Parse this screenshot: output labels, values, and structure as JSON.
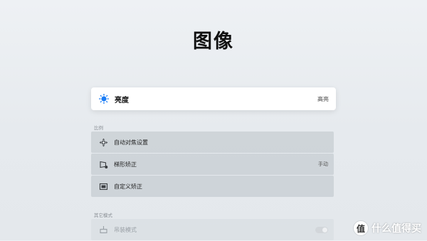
{
  "title": "图像",
  "brightness": {
    "label": "亮度",
    "value": "高亮",
    "icon": "sun-icon",
    "icon_color": "#1a7cf5"
  },
  "sections": [
    {
      "title": "比例",
      "items": [
        {
          "label": "自动对焦设置",
          "value": "",
          "icon": "autofocus-icon"
        },
        {
          "label": "梯形矫正",
          "value": "手动",
          "icon": "keystone-icon"
        },
        {
          "label": "自定义矫正",
          "value": "",
          "icon": "custom-correction-icon"
        }
      ]
    },
    {
      "title": "其它模式",
      "items": [
        {
          "label": "吊装模式",
          "value": "",
          "icon": "ceiling-mount-icon",
          "toggle": false
        }
      ]
    }
  ],
  "watermark": {
    "badge": "值",
    "text": "什么值得买"
  }
}
